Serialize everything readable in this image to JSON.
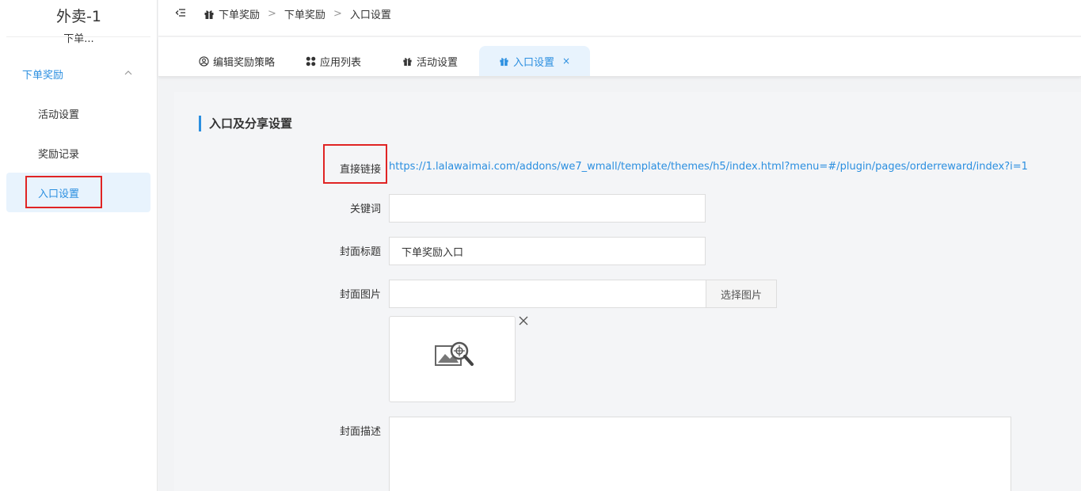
{
  "sidebar": {
    "app_title": "外卖-1",
    "app_subtitle": "下单...",
    "group_label": "下单奖励",
    "items": [
      {
        "label": "活动设置"
      },
      {
        "label": "奖励记录"
      },
      {
        "label": "入口设置"
      }
    ]
  },
  "breadcrumb": [
    "下单奖励",
    "下单奖励",
    "入口设置"
  ],
  "tabs": [
    {
      "label": "编辑奖励策略",
      "icon": "user-circle-icon"
    },
    {
      "label": "应用列表",
      "icon": "grid-icon"
    },
    {
      "label": "活动设置",
      "icon": "gift-icon"
    },
    {
      "label": "入口设置",
      "icon": "gift-icon",
      "close": "×"
    }
  ],
  "form": {
    "section_title": "入口及分享设置",
    "direct_link_label": "直接链接",
    "direct_link_url": "https://1.lalawaimai.com/addons/we7_wmall/template/themes/h5/index.html?menu=#/plugin/pages/orderreward/index?i=1",
    "keyword_label": "关键词",
    "keyword_value": "",
    "cover_title_label": "封面标题",
    "cover_title_value": "下单奖励入口",
    "cover_image_label": "封面图片",
    "cover_image_value": "",
    "pick_image_button": "选择图片",
    "cover_desc_label": "封面描述",
    "cover_desc_value": ""
  },
  "colors": {
    "accent": "#2b8fe0",
    "highlight_box": "#e02424"
  }
}
